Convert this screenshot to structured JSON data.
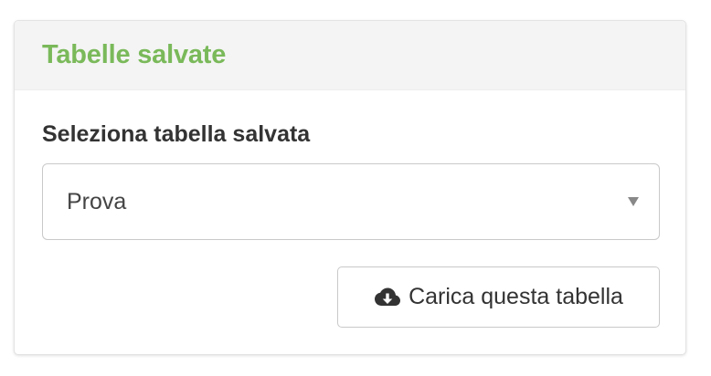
{
  "panel": {
    "title": "Tabelle salvate"
  },
  "form": {
    "select_label": "Seleziona tabella salvata",
    "selected_value": "Prova",
    "load_button_label": "Carica questa tabella",
    "load_button_icon": "cloud-download-icon"
  },
  "colors": {
    "title_accent": "#7ab95a",
    "heading_bg": "#f4f4f4",
    "border": "#c9c9c9",
    "text": "#333333"
  }
}
